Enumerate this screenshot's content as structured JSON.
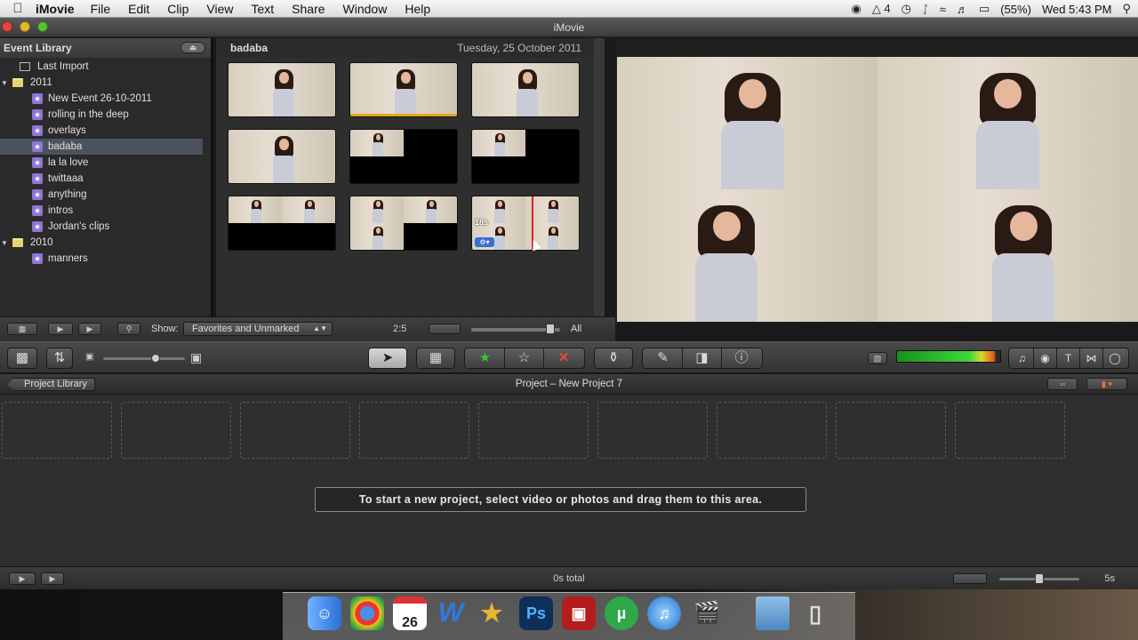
{
  "menubar": {
    "app_name": "iMovie",
    "items": [
      "File",
      "Edit",
      "Clip",
      "View",
      "Text",
      "Share",
      "Window",
      "Help"
    ],
    "status": {
      "adobe_badge": "4",
      "battery": "(55%)",
      "clock": "Wed 5:43 PM"
    }
  },
  "window": {
    "title": "iMovie"
  },
  "event_library": {
    "header": "Event Library",
    "last_import": "Last Import",
    "years": [
      {
        "label": "2011",
        "events": [
          "New Event 26-10-2011",
          "rolling in the deep",
          "overlays",
          "badaba",
          "la la love",
          "twittaaa",
          "anything",
          "intros",
          "Jordan's clips"
        ]
      },
      {
        "label": "2010",
        "events": [
          "manners"
        ]
      }
    ],
    "selected_event": "badaba"
  },
  "event_browser": {
    "event_name": "badaba",
    "date": "Tuesday, 25 October 2011",
    "clip_badge": "18s"
  },
  "browser_bar": {
    "show_label": "Show:",
    "show_value": "Favorites and Unmarked",
    "duration": "2:5",
    "all_label": "All"
  },
  "project": {
    "back_label": "Project Library",
    "title": "Project – New Project 7",
    "hint": "To start a new project, select video or photos and drag them to this area.",
    "total": "0s total",
    "zoom": "5s"
  },
  "dock": {
    "calendar_day": "26"
  },
  "colors": {
    "selection": "#4c525b",
    "event_star": "#8e74d9",
    "folder": "#e6d36a",
    "favorite": "#3ec13e",
    "reject": "#e04a3a"
  }
}
